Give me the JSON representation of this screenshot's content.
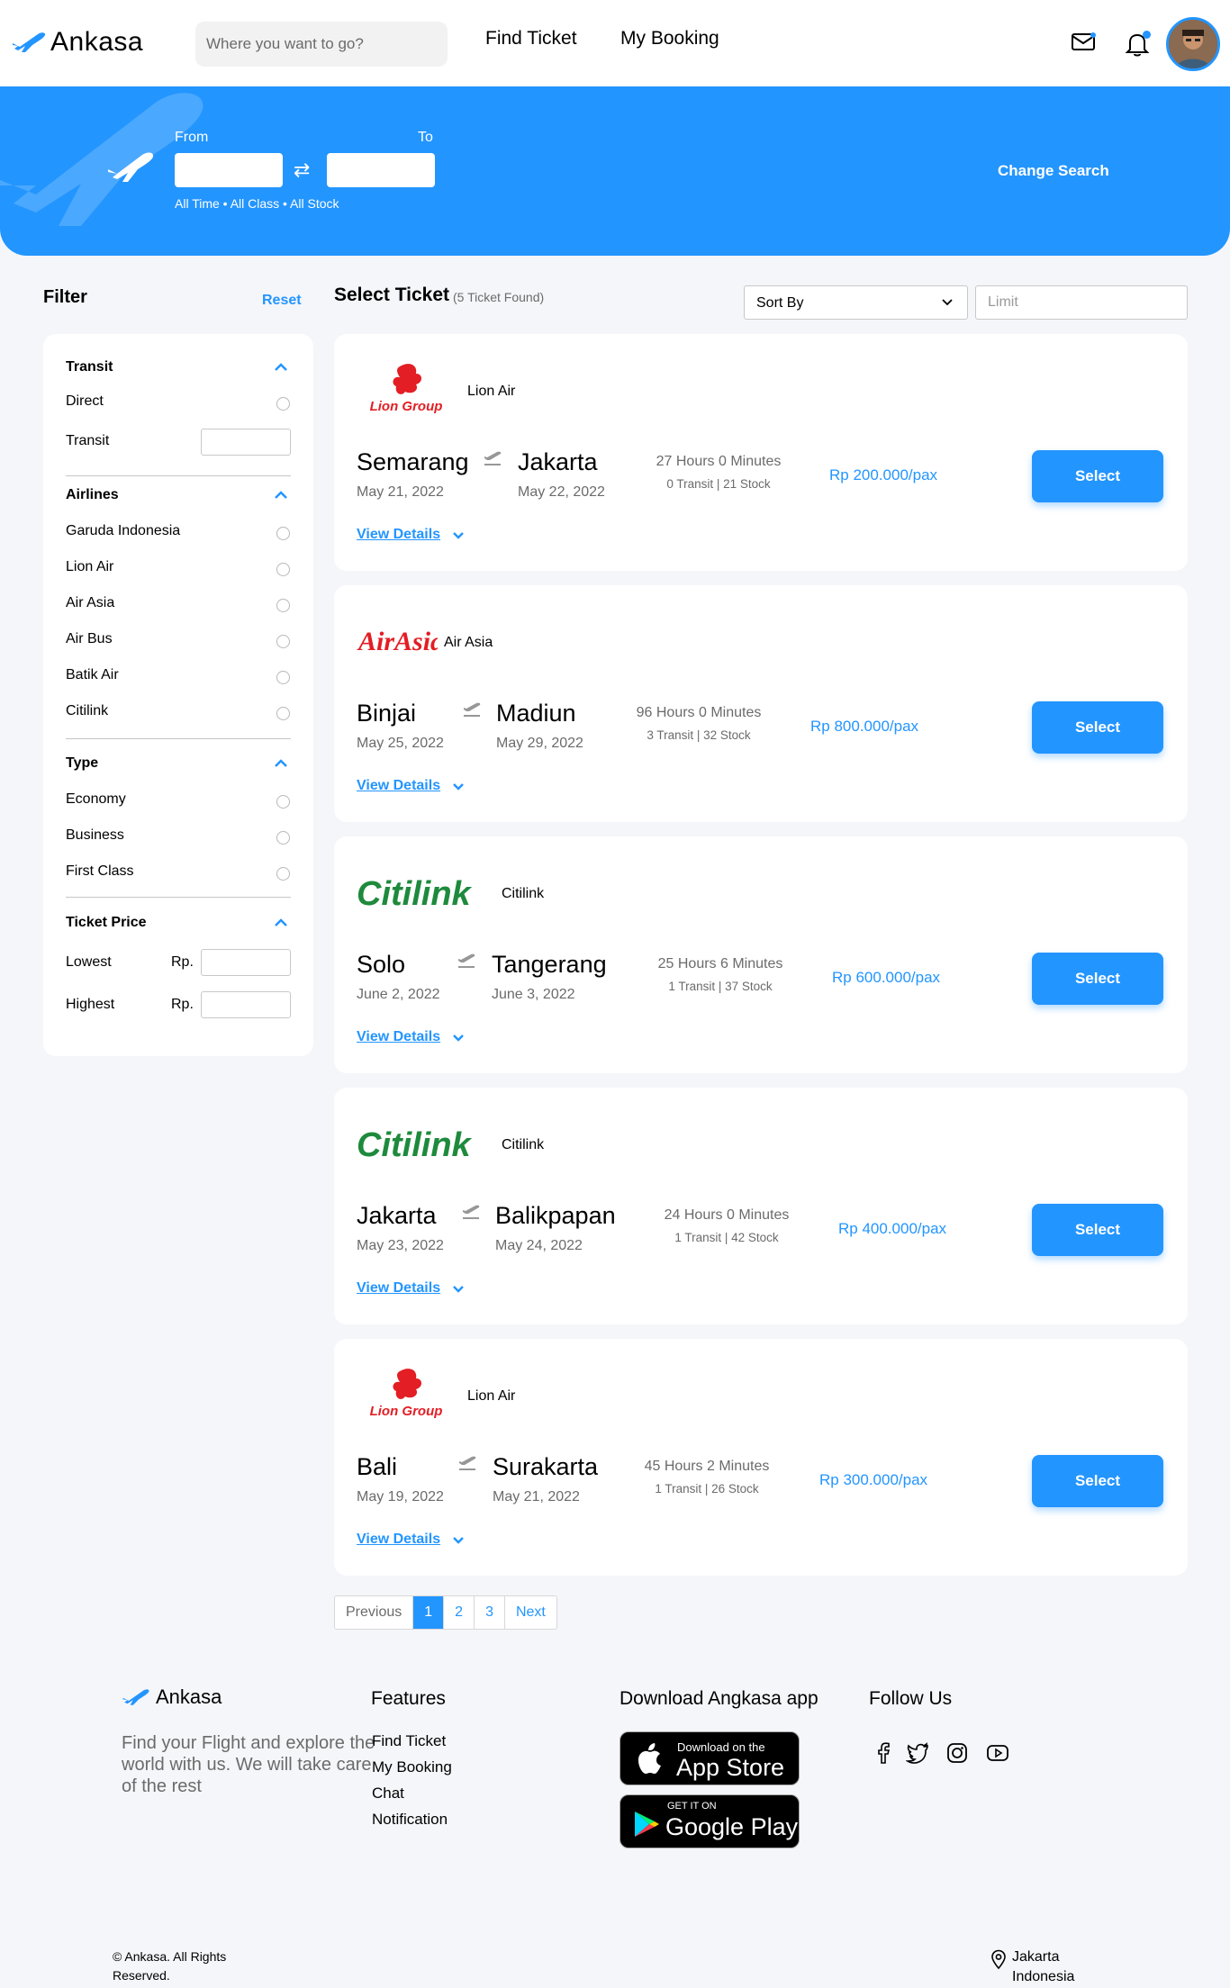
{
  "header": {
    "brand": "Ankasa",
    "search_placeholder": "Where you want to go?",
    "nav": [
      "Find Ticket",
      "My Booking"
    ]
  },
  "hero": {
    "from_label": "From",
    "to_label": "To",
    "meta": "All Time • All Class • All Stock",
    "change_search": "Change Search"
  },
  "filter": {
    "title": "Filter",
    "reset": "Reset",
    "transit_title": "Transit",
    "transit_items": [
      "Direct",
      "Transit"
    ],
    "airlines_title": "Airlines",
    "airlines": [
      "Garuda Indonesia",
      "Lion Air",
      "Air Asia",
      "Air Bus",
      "Batik Air",
      "Citilink"
    ],
    "type_title": "Type",
    "types": [
      "Economy",
      "Business",
      "First Class"
    ],
    "price_title": "Ticket Price",
    "lowest": "Lowest",
    "highest": "Highest",
    "currency": "Rp."
  },
  "select": {
    "title": "Select Ticket",
    "count": "(5 Ticket Found)",
    "sort_label": "Sort By",
    "limit_placeholder": "Limit",
    "select_label": "Select",
    "view_details": "View Details"
  },
  "tickets": [
    {
      "airline": "Lion Air",
      "logo_text": "Lion Group",
      "from": "Semarang",
      "to": "Jakarta",
      "date_from": "May 21, 2022",
      "date_to": "May 22, 2022",
      "duration": "27 Hours 0 Minutes",
      "transit": "0 Transit | 21 Stock",
      "price": "Rp 200.000/pax"
    },
    {
      "airline": "Air Asia",
      "logo_text": "AirAsia",
      "from": "Binjai",
      "to": "Madiun",
      "date_from": "May 25, 2022",
      "date_to": "May 29, 2022",
      "duration": "96 Hours 0 Minutes",
      "transit": "3 Transit | 32 Stock",
      "price": "Rp 800.000/pax"
    },
    {
      "airline": "Citilink",
      "logo_text": "Citilink",
      "from": "Solo",
      "to": "Tangerang",
      "date_from": "June 2, 2022",
      "date_to": "June 3, 2022",
      "duration": "25 Hours 6 Minutes",
      "transit": "1 Transit | 37 Stock",
      "price": "Rp 600.000/pax"
    },
    {
      "airline": "Citilink",
      "logo_text": "Citilink",
      "from": "Jakarta",
      "to": "Balikpapan",
      "date_from": "May 23, 2022",
      "date_to": "May 24, 2022",
      "duration": "24 Hours 0 Minutes",
      "transit": "1 Transit | 42 Stock",
      "price": "Rp 400.000/pax"
    },
    {
      "airline": "Lion Air",
      "logo_text": "Lion Group",
      "from": "Bali",
      "to": "Surakarta",
      "date_from": "May 19, 2022",
      "date_to": "May 21, 2022",
      "duration": "45 Hours 2 Minutes",
      "transit": "1 Transit | 26 Stock",
      "price": "Rp 300.000/pax"
    }
  ],
  "pagination": {
    "previous": "Previous",
    "pages": [
      "1",
      "2",
      "3"
    ],
    "next": "Next"
  },
  "footer": {
    "brand": "Ankasa",
    "description": "Find your Flight and explore the world with us. We will take care of the rest",
    "features_title": "Features",
    "features": [
      "Find Ticket",
      "My Booking",
      "Chat",
      "Notification"
    ],
    "download_title": "Download Angkasa app",
    "appstore_small": "Download on the",
    "appstore_big": "App Store",
    "googleplay_small": "GET IT ON",
    "googleplay_big": "Google Play",
    "follow_title": "Follow Us",
    "social_icons": [
      "facebook-icon",
      "twitter-icon",
      "instagram-icon",
      "youtube-icon"
    ],
    "copyright": "© Ankasa. All Rights Reserved.",
    "location_city": "Jakarta",
    "location_country": "Indonesia"
  },
  "colors": {
    "primary": "#2395ff",
    "lion_red": "#e31e24",
    "citilink_green": "#1e8a3c"
  }
}
